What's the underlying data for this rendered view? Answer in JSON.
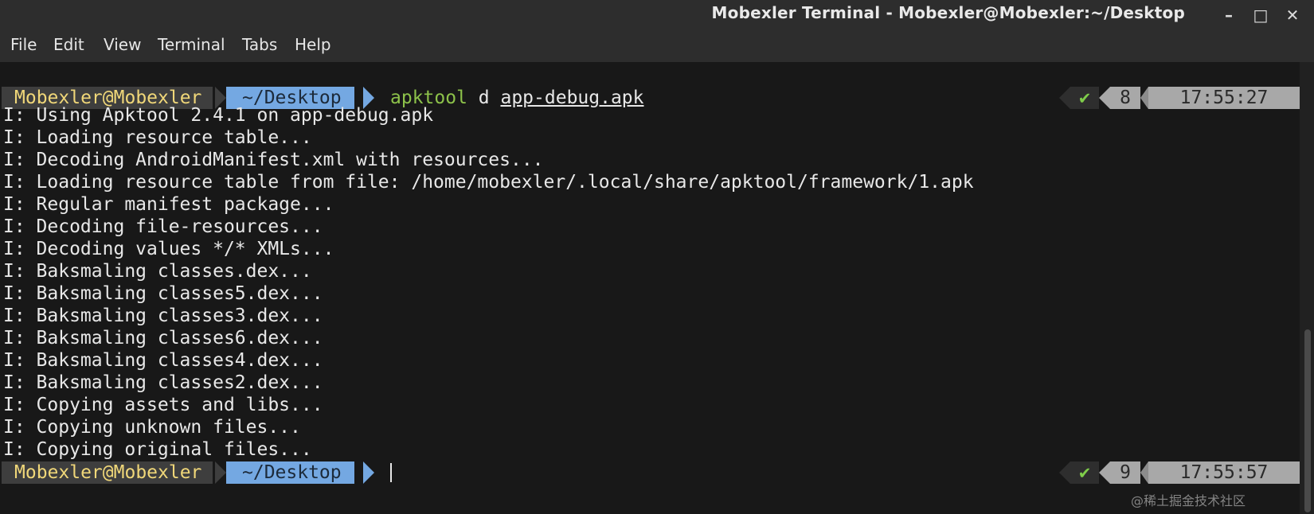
{
  "window": {
    "title": "Mobexler Terminal - Mobexler@Mobexler:~/Desktop",
    "controls": {
      "minimize": "–",
      "maximize": "□",
      "close": "✕"
    }
  },
  "menu": {
    "items": [
      "File",
      "Edit",
      "View",
      "Terminal",
      "Tabs",
      "Help"
    ]
  },
  "prompt": {
    "user_host": "Mobexler@Mobexler",
    "directory": "~/Desktop"
  },
  "first_prompt": {
    "command_program": "apktool",
    "command_flag": " d ",
    "command_argument": "app-debug.apk",
    "status_icon": "✔",
    "history_number": "8",
    "time": "17:55:27"
  },
  "output_lines": [
    "I: Using Apktool 2.4.1 on app-debug.apk",
    "I: Loading resource table...",
    "I: Decoding AndroidManifest.xml with resources...",
    "I: Loading resource table from file: /home/mobexler/.local/share/apktool/framework/1.apk",
    "I: Regular manifest package...",
    "I: Decoding file-resources...",
    "I: Decoding values */* XMLs...",
    "I: Baksmaling classes.dex...",
    "I: Baksmaling classes5.dex...",
    "I: Baksmaling classes3.dex...",
    "I: Baksmaling classes6.dex...",
    "I: Baksmaling classes4.dex...",
    "I: Baksmaling classes2.dex...",
    "I: Copying assets and libs...",
    "I: Copying unknown files...",
    "I: Copying original files..."
  ],
  "second_prompt": {
    "status_icon": "✔",
    "history_number": "9",
    "time": "17:55:57"
  },
  "watermark": "@稀土掘金技术社区",
  "colors": {
    "terminal_bg": "#181818",
    "user_fg": "#f0d779",
    "dir_bg": "#74a8e2",
    "command_green": "#8dc24a",
    "status_check": "#7fcd4a",
    "status_bg": "#a8a8a8"
  }
}
